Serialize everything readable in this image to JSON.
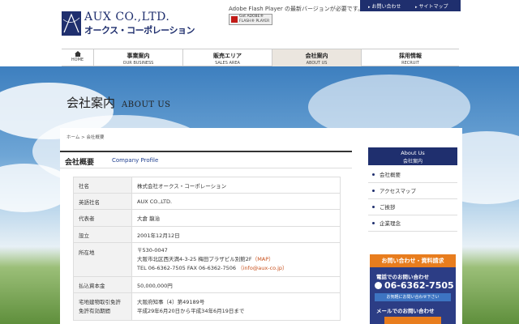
{
  "header": {
    "logo_en": "AUX CO.,LTD.",
    "logo_jp": "オークス・コーポレーション",
    "flash_note": "Adobe Flash Player の最新バージョンが必要です。",
    "flash_badge": "Get ADOBE® FLASH® PLAYER",
    "top_links": [
      {
        "label": "お問い合わせ"
      },
      {
        "label": "サイトマップ"
      }
    ]
  },
  "nav": {
    "home_label": "HOME",
    "items": [
      {
        "jp": "事業案内",
        "en": "OUR BUSINESS"
      },
      {
        "jp": "販売エリア",
        "en": "SALES AREA"
      },
      {
        "jp": "会社案内",
        "en": "ABOUT US"
      },
      {
        "jp": "採用情報",
        "en": "RECRUIT"
      }
    ]
  },
  "hero": {
    "title_jp": "会社案内",
    "title_en": "ABOUT US"
  },
  "breadcrumb": "ホーム > 会社概要",
  "section": {
    "title_jp": "会社概要",
    "title_en": "Company Profile"
  },
  "table": {
    "rows": [
      {
        "label": "社名",
        "lines": [
          "株式会社オークス・コーポレーション"
        ]
      },
      {
        "label": "英語社名",
        "lines": [
          "AUX CO.,LTD."
        ]
      },
      {
        "label": "代表者",
        "lines": [
          "大倉 龍治"
        ]
      },
      {
        "label": "設立",
        "lines": [
          "2001年12月12日"
        ]
      },
      {
        "label": "所在地",
        "lines": [
          "〒530-0047",
          "大阪市北区西天満4-3-25 梅田プラザビル別館2F",
          "TEL 06-6362-7505 FAX 06-6362-7506"
        ],
        "map_link": "（MAP）",
        "mail_link": "（info@aux-co.jp）"
      },
      {
        "label": "払込資本金",
        "lines": [
          "50,000,000円"
        ]
      },
      {
        "label": "宅地建物取引免許",
        "label2": "免許有効期間",
        "lines": [
          "大阪府知事（4）第49189号",
          "平成29年6月20日から平成34年6月19日まで"
        ]
      }
    ]
  },
  "sidebar": {
    "head_en": "About Us",
    "head_jp": "会社案内",
    "items": [
      {
        "label": "会社概要"
      },
      {
        "label": "アクセスマップ"
      },
      {
        "label": "ご挨拶"
      },
      {
        "label": "企業理念"
      }
    ]
  },
  "contact": {
    "head": "お問い合わせ・資料請求",
    "tel_label": "電話でのお問い合わせ",
    "tel": "06-6362-7505",
    "sub": "お気軽にお問い合わせ下さい",
    "mail_label": "メールでのお問い合わせ"
  },
  "colors": {
    "brand_navy": "#1f2f6e",
    "accent_orange": "#e87d1e",
    "link_orange": "#c8501c"
  }
}
